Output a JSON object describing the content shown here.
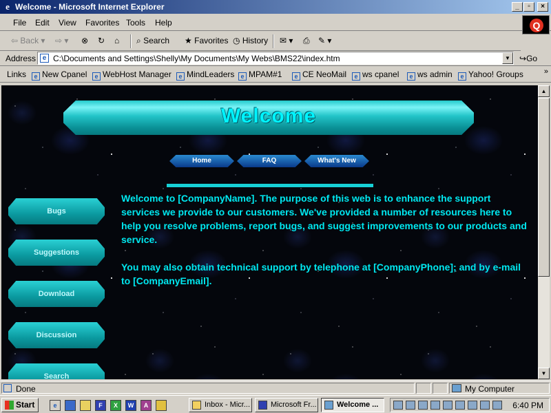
{
  "window": {
    "title": "Welcome - Microsoft Internet Explorer",
    "minimize": "_",
    "maximize": "▫",
    "close": "×"
  },
  "menu": [
    "File",
    "Edit",
    "View",
    "Favorites",
    "Tools",
    "Help"
  ],
  "toolbar": {
    "back": "Back",
    "forward": "",
    "stop": "",
    "refresh": "",
    "home": "",
    "search": "Search",
    "favorites": "Favorites",
    "history": "History"
  },
  "address": {
    "label": "Address",
    "value": "C:\\Documents and Settings\\Shelly\\My Documents\\My Webs\\BMS22\\index.htm",
    "go": "Go"
  },
  "links": {
    "label": "Links",
    "items": [
      "New Cpanel",
      "WebHost Manager",
      "MindLeaders",
      "MPAM#1",
      "CE NeoMail",
      "ws cpanel",
      "ws admin",
      "Yahoo! Groups"
    ]
  },
  "page": {
    "banner": "Welcome",
    "nav": [
      "Home",
      "FAQ",
      "What's New"
    ],
    "sidebar": [
      "Bugs",
      "Suggestions",
      "Download",
      "Discussion",
      "Search"
    ],
    "paragraphs": [
      "Welcome to [CompanyName]. The purpose of this web is to enhance the support services we provide to our customers. We've provided a number of resources here to help you resolve problems, report bugs, and suggest improvements to our products and service.",
      "You may also obtain technical support by telephone at [CompanyPhone]; and by e-mail to [CompanyEmail]."
    ]
  },
  "status": {
    "text": "Done",
    "zone": "My Computer"
  },
  "taskbar": {
    "start": "Start",
    "tasks": [
      "Inbox - Micr...",
      "Microsoft Fr...",
      "Welcome ..."
    ],
    "clock": "6:40 PM"
  },
  "colors": {
    "title_bar_start": "#0a246a",
    "page_text": "#00e8f0",
    "banner_text": "#00f4ff",
    "nav_button": "#1a6ab8",
    "side_button": "#0ea8ae"
  }
}
